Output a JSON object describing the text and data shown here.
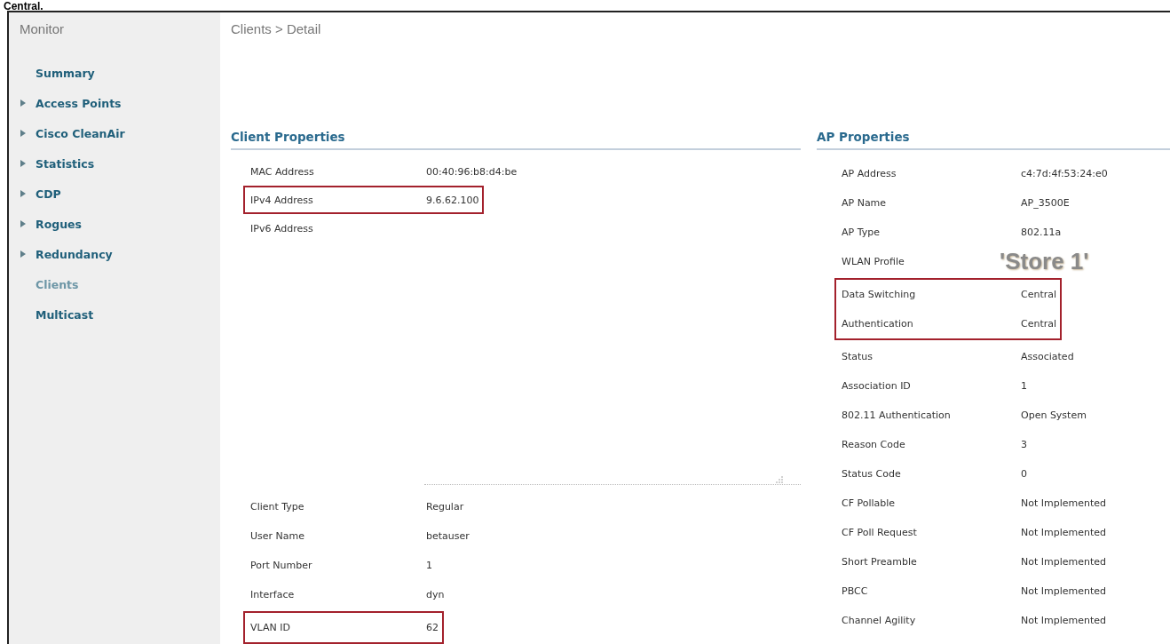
{
  "caption": "Central.",
  "sidebar": {
    "title": "Monitor",
    "items": [
      {
        "label": "Summary",
        "expandable": false,
        "selected": false
      },
      {
        "label": "Access Points",
        "expandable": true,
        "selected": false
      },
      {
        "label": "Cisco CleanAir",
        "expandable": true,
        "selected": false
      },
      {
        "label": "Statistics",
        "expandable": true,
        "selected": false
      },
      {
        "label": "CDP",
        "expandable": true,
        "selected": false
      },
      {
        "label": "Rogues",
        "expandable": true,
        "selected": false
      },
      {
        "label": "Redundancy",
        "expandable": true,
        "selected": false
      },
      {
        "label": "Clients",
        "expandable": false,
        "selected": true
      },
      {
        "label": "Multicast",
        "expandable": false,
        "selected": false
      }
    ]
  },
  "breadcrumb": "Clients > Detail",
  "client_properties": {
    "title": "Client Properties",
    "upper": [
      {
        "kind": "plain",
        "rows": [
          {
            "label": "MAC Address",
            "value": "00:40:96:b8:d4:be"
          }
        ]
      },
      {
        "kind": "highlighted",
        "rows": [
          {
            "label": "IPv4 Address",
            "value": "9.6.62.100"
          }
        ]
      },
      {
        "kind": "plain",
        "rows": [
          {
            "label": "IPv6 Address"
          }
        ]
      }
    ],
    "lower": [
      {
        "kind": "plain",
        "rows": [
          {
            "label": "Client Type",
            "value": "Regular"
          },
          {
            "label": "User Name",
            "value": "betauser"
          },
          {
            "label": "Port Number",
            "value": "1"
          },
          {
            "label": "Interface",
            "value": "dyn"
          }
        ]
      },
      {
        "kind": "highlighted",
        "rows": [
          {
            "label": "VLAN ID",
            "value": "62"
          }
        ]
      }
    ]
  },
  "ap_properties": {
    "title": "AP Properties",
    "groups": [
      {
        "kind": "plain",
        "rows": [
          {
            "label": "AP Address",
            "value": "c4:7d:4f:53:24:e0"
          },
          {
            "label": "AP Name",
            "value": "AP_3500E"
          },
          {
            "label": "AP Type",
            "value": "802.11a"
          },
          {
            "label": "WLAN Profile",
            "value": "'Store 1'",
            "emphasis": true
          }
        ]
      },
      {
        "kind": "highlighted",
        "rows": [
          {
            "label": "Data Switching",
            "value": "Central"
          },
          {
            "label": "Authentication",
            "value": "Central"
          }
        ]
      },
      {
        "kind": "plain",
        "rows": [
          {
            "label": "Status",
            "value": "Associated"
          },
          {
            "label": "Association ID",
            "value": "1"
          },
          {
            "label": "802.11 Authentication",
            "value": "Open System"
          },
          {
            "label": "Reason Code",
            "value": "3"
          },
          {
            "label": "Status Code",
            "value": "0"
          },
          {
            "label": "CF Pollable",
            "value": "Not Implemented"
          },
          {
            "label": "CF Poll Request",
            "value": "Not Implemented"
          },
          {
            "label": "Short Preamble",
            "value": "Not Implemented"
          },
          {
            "label": "PBCC",
            "value": "Not Implemented"
          },
          {
            "label": "Channel Agility",
            "value": "Not Implemented"
          }
        ]
      }
    ]
  }
}
